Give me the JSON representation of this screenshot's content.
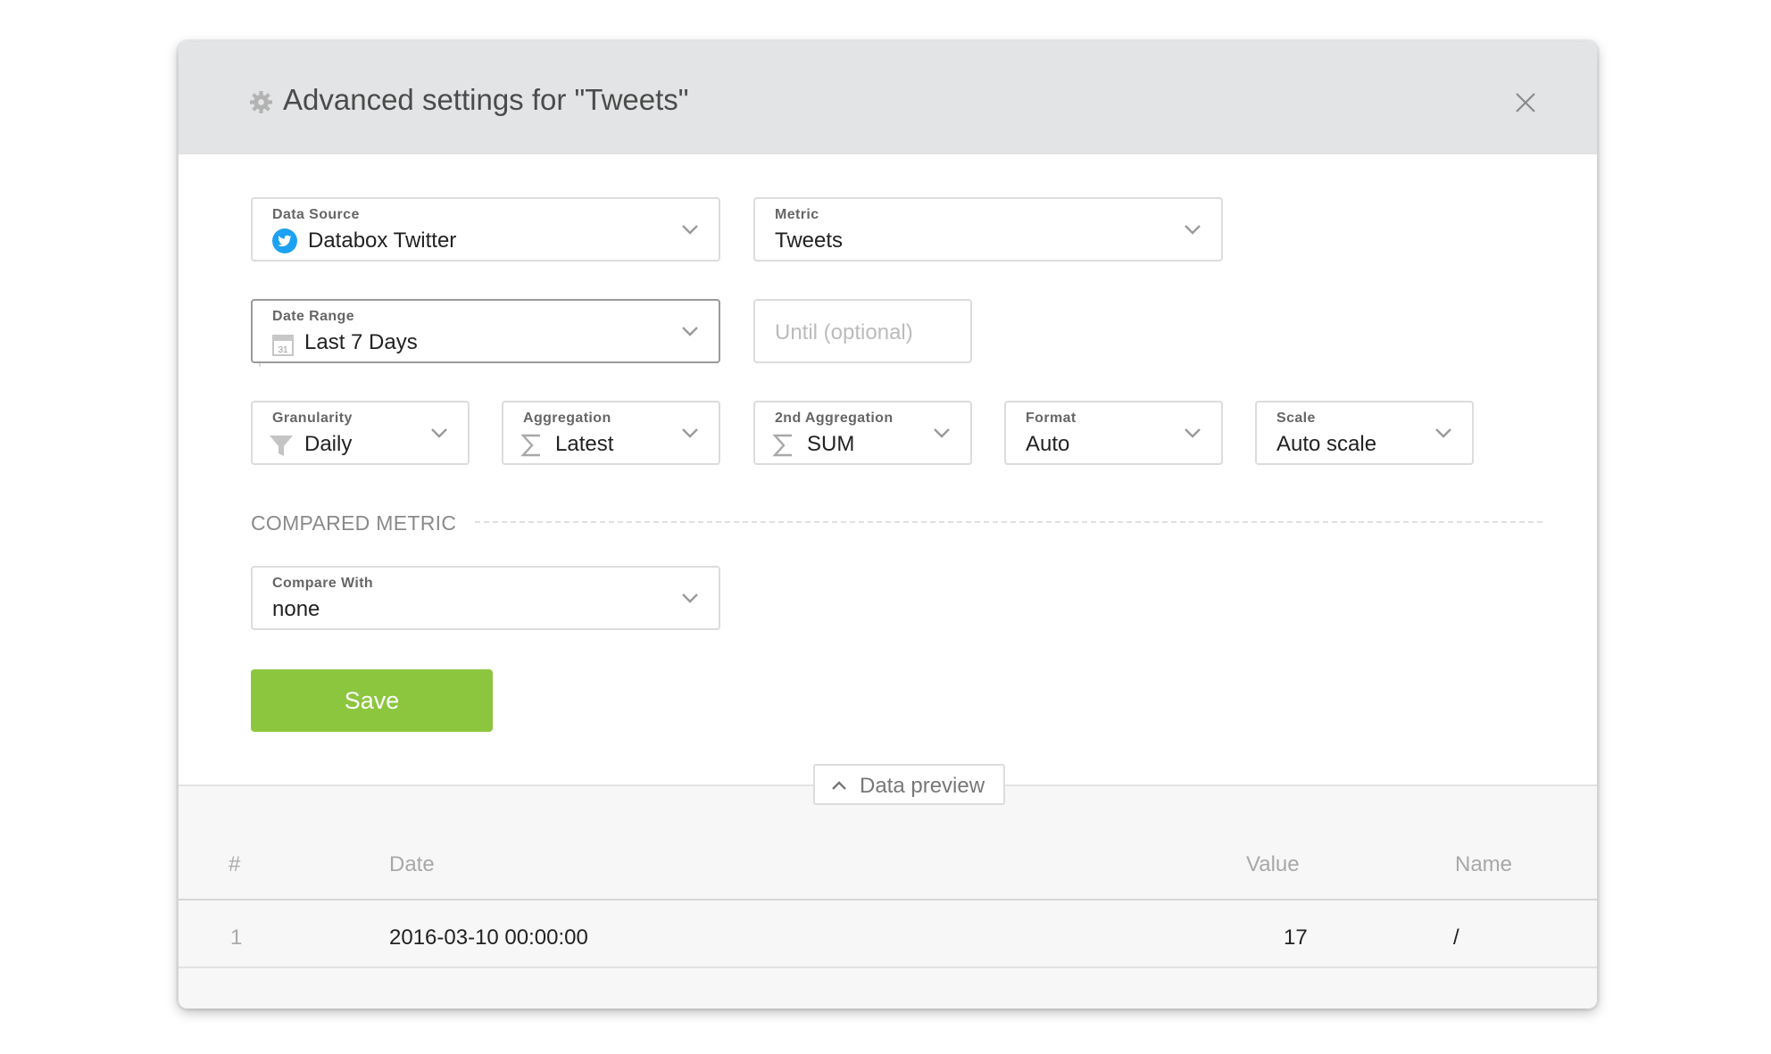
{
  "modal": {
    "title": "Advanced settings for \"Tweets\"",
    "icons": {
      "title": "gear-icon",
      "close": "close-icon"
    }
  },
  "fields": {
    "data_source": {
      "label": "Data Source",
      "value": "Databox Twitter",
      "icon": "twitter-icon"
    },
    "metric": {
      "label": "Metric",
      "value": "Tweets"
    },
    "date_range": {
      "label": "Date Range",
      "value": "Last 7 Days",
      "icon": "calendar-icon",
      "icon_text": "31"
    },
    "until": {
      "placeholder": "Until (optional)"
    },
    "granularity": {
      "label": "Granularity",
      "value": "Daily",
      "icon": "funnel-icon"
    },
    "aggregation": {
      "label": "Aggregation",
      "value": "Latest",
      "icon": "sigma-icon"
    },
    "aggregation2": {
      "label": "2nd Aggregation",
      "value": "SUM",
      "icon": "sigma-icon"
    },
    "format": {
      "label": "Format",
      "value": "Auto"
    },
    "scale": {
      "label": "Scale",
      "value": "Auto scale"
    }
  },
  "compared": {
    "section_title": "COMPARED METRIC",
    "compare_with": {
      "label": "Compare With",
      "value": "none"
    }
  },
  "actions": {
    "save_label": "Save"
  },
  "preview": {
    "toggle_label": "Data preview",
    "columns": {
      "index": "#",
      "date": "Date",
      "value": "Value",
      "name": "Name"
    },
    "rows": [
      {
        "index": "1",
        "date": "2016-03-10 00:00:00",
        "value": "17",
        "name": "/"
      }
    ]
  },
  "colors": {
    "accent_save": "#8cc63f",
    "twitter_blue": "#1da1f2",
    "header_bg": "#e3e4e5"
  }
}
